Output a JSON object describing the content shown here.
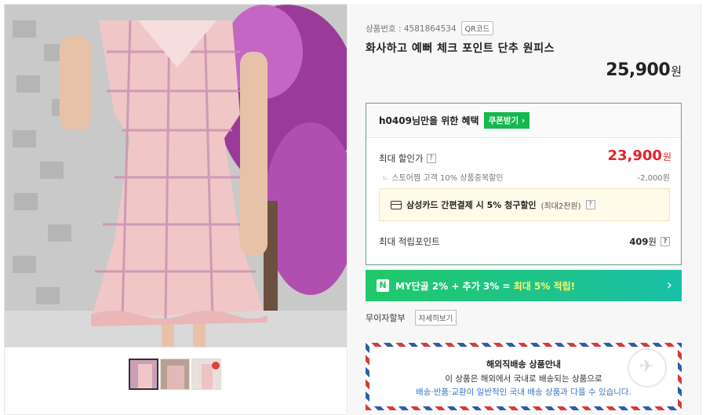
{
  "product": {
    "code_label": "상품번호 : 4581864534",
    "qr_label": "QR코드",
    "title": "화사하고 예뻐 체크 포인트 단추 원피스",
    "price": "25,900",
    "currency": "원"
  },
  "benefit": {
    "title": "h0409님만을 위한 혜택",
    "coupon_label": "쿠폰받기",
    "max_discount_label": "최대 할인가",
    "max_price": "23,900",
    "max_price_unit": "원",
    "store_discount_label": "스토어찜 고객 10% 상품중복할인",
    "store_discount_value": "-2,000원",
    "card_text": "삼성카드 간편결제 시 5% 청구할인",
    "card_sub": "(최대2천원)",
    "help_glyph": "?",
    "points_label": "최대 적립포인트",
    "points_value": "409",
    "points_unit": "원"
  },
  "my_banner": {
    "badge": "N",
    "text_prefix": "MY단골 2% + 추가 3% = ",
    "text_highlight": "최대 5% 적립!",
    "arrow": "›"
  },
  "installment": {
    "label": "무이자할부",
    "detail_label": "자세히보기"
  },
  "overseas": {
    "title": "해외직배송 상품안내",
    "line1": "이 상품은 해외에서 국내로 배송되는 상품으로",
    "line2": "배송·반품·교환이 일반적인 국내 배송 상품과 다를 수 있습니다."
  },
  "colors": {
    "accent_green": "#16b84e",
    "discount_red": "#e8202a",
    "banner_highlight": "#fff46b"
  },
  "images": {
    "main": "product-photo-plaid-dress",
    "thumbnails": [
      "thumb-1",
      "thumb-2",
      "thumb-3"
    ]
  }
}
